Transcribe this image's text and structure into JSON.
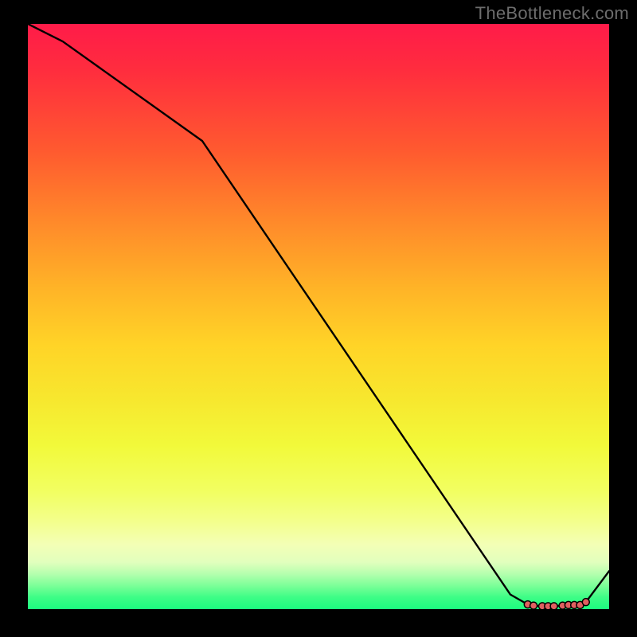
{
  "watermark": "TheBottleneck.com",
  "chart_data": {
    "type": "line",
    "title": "",
    "xlabel": "",
    "ylabel": "",
    "xlim": [
      0,
      100
    ],
    "ylim": [
      0,
      100
    ],
    "grid": false,
    "x": [
      0,
      6,
      30,
      83,
      86,
      87,
      88.5,
      89.5,
      90.5,
      92,
      93,
      94,
      95,
      96,
      100
    ],
    "y": [
      100,
      97,
      80,
      2.5,
      0.8,
      0.6,
      0.5,
      0.5,
      0.5,
      0.6,
      0.7,
      0.7,
      0.7,
      1.2,
      6.5
    ],
    "markers_x": [
      86,
      87,
      88.5,
      89.5,
      90.5,
      92,
      93,
      94,
      95,
      96
    ],
    "markers_y": [
      0.8,
      0.6,
      0.5,
      0.5,
      0.5,
      0.6,
      0.7,
      0.7,
      0.7,
      1.2
    ]
  },
  "colors": {
    "background": "#000000",
    "watermark": "#6d6d6d",
    "line": "#000000",
    "marker": "#e06060"
  }
}
